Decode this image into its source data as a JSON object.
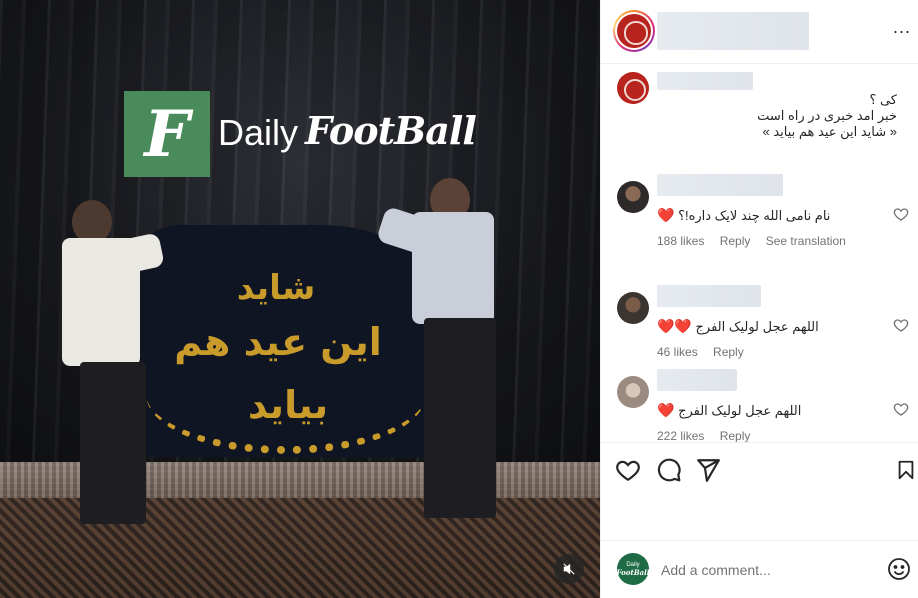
{
  "post_image": {
    "logo": {
      "letter": "F",
      "word_a": "Daily",
      "word_b": "FootBall",
      "color": "#4a8b5b"
    },
    "banner_lines": [
      "شاید",
      "این عید هم",
      "بیاید"
    ],
    "banner_text_color": "#c89b2a"
  },
  "header": {
    "more_label": "..."
  },
  "caption": {
    "lines": [
      "کی ؟",
      "خبر امد خبری در راه است",
      "« شاید این عید هم بیاید »"
    ]
  },
  "comments": [
    {
      "text": "نام نامی الله چند لایک داره!؟",
      "hearts": "❤️",
      "likes": "188 likes",
      "reply": "Reply",
      "translate": "See translation"
    },
    {
      "text": "اللهم عجل لولیک الفرج",
      "hearts": "❤️❤️",
      "likes": "46 likes",
      "reply": "Reply"
    },
    {
      "text": "اللهم عجل لولیک الفرج",
      "hearts": "❤️",
      "likes": "222 likes",
      "reply": "Reply"
    }
  ],
  "add_comment": {
    "placeholder": "Add a comment...",
    "avatar_line1": "Daily",
    "avatar_line2": "FootBall"
  },
  "colors": {
    "accent_heart": "#e0245e",
    "meta_gray": "#737373",
    "text": "#262626",
    "divider": "#efefef"
  }
}
